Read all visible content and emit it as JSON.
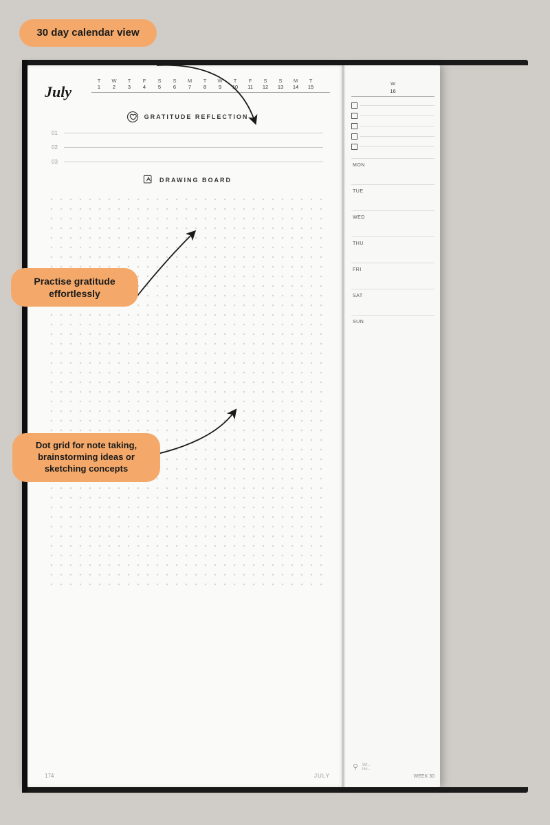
{
  "page": {
    "month": "July",
    "calendar": {
      "day_letters": [
        "T",
        "W",
        "T",
        "F",
        "S",
        "S",
        "M",
        "T",
        "W",
        "T",
        "F",
        "S",
        "S",
        "M",
        "T"
      ],
      "day_numbers": [
        "1",
        "2",
        "3",
        "4",
        "5",
        "6",
        "7",
        "8",
        "9",
        "10",
        "11",
        "12",
        "13",
        "14",
        "15"
      ],
      "right_col_letter": "W",
      "right_col_number": "16"
    },
    "gratitude": {
      "title": "GRATITUDE REFLECTION",
      "lines": [
        "01",
        "02",
        "03"
      ]
    },
    "drawing_board": {
      "title": "DRAWING BOARD"
    },
    "footer": {
      "page_number": "174",
      "month_label": "JULY",
      "week_label": "WEEK 30"
    },
    "right_page": {
      "days": [
        "MON",
        "TUE",
        "WED",
        "THU",
        "FRI",
        "SAT",
        "SUN"
      ],
      "checkboxes_count": 5,
      "footer_text": "WEEK 30",
      "lightbulb_text": "Wr... lev..."
    }
  },
  "annotations": {
    "calendar_view": "30 day calendar view",
    "gratitude": "Practise gratitude\neffortlessly",
    "dot_grid": "Dot grid for note taking,\nbrainstorming ideas or\nsketching concepts"
  }
}
